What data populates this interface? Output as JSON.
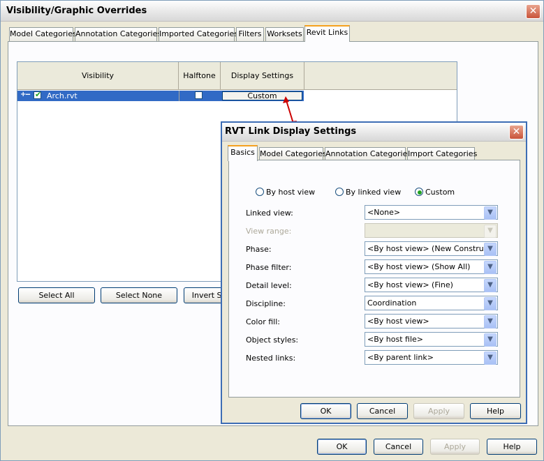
{
  "outer": {
    "title": "Visibility/Graphic Overrides",
    "tabs": [
      "Model Categories",
      "Annotation Categories",
      "Imported Categories",
      "Filters",
      "Worksets",
      "Revit Links"
    ],
    "active_tab": "Revit Links",
    "grid": {
      "columns": [
        "Visibility",
        "Halftone",
        "Display Settings"
      ],
      "rows": [
        {
          "expander": "+--",
          "visible": true,
          "name": "Arch.rvt",
          "halftone": false,
          "display": "Custom"
        }
      ]
    },
    "buttons": {
      "select_all": "Select All",
      "select_none": "Select None",
      "invert": "Invert Selection"
    },
    "footer": {
      "ok": "OK",
      "cancel": "Cancel",
      "apply": "Apply",
      "help": "Help"
    }
  },
  "inner": {
    "title": "RVT Link Display Settings",
    "tabs": [
      "Basics",
      "Model Categories",
      "Annotation Categories",
      "Import Categories"
    ],
    "active_tab": "Basics",
    "radios": [
      {
        "label": "By host view",
        "selected": false
      },
      {
        "label": "By linked view",
        "selected": false
      },
      {
        "label": "Custom",
        "selected": true
      }
    ],
    "fields": [
      {
        "label": "Linked view:",
        "value": "<None>",
        "enabled": true
      },
      {
        "label": "View range:",
        "value": "",
        "enabled": false
      },
      {
        "label": "Phase:",
        "value": "<By host view> (New Construction)",
        "enabled": true
      },
      {
        "label": "Phase filter:",
        "value": "<By host view> (Show All)",
        "enabled": true
      },
      {
        "label": "Detail level:",
        "value": "<By host view> (Fine)",
        "enabled": true
      },
      {
        "label": "Discipline:",
        "value": "Coordination",
        "enabled": true
      },
      {
        "label": "Color fill:",
        "value": "<By host view>",
        "enabled": true
      },
      {
        "label": "Object styles:",
        "value": "<By host file>",
        "enabled": true
      },
      {
        "label": "Nested links:",
        "value": "<By parent link>",
        "enabled": true
      }
    ],
    "footer": {
      "ok": "OK",
      "cancel": "Cancel",
      "apply": "Apply",
      "help": "Help"
    }
  },
  "icons": {
    "close": "close-icon",
    "dropdown": "chevron-down-icon",
    "check": "checkmark-icon",
    "connector": "double-arrow-icon"
  },
  "colors": {
    "selection": "#316ac5",
    "active_tab_accent": "#f5a11e",
    "close_button": "#c9543a",
    "connector_arrow": "#cc0000",
    "radio_dot": "#21a121"
  }
}
